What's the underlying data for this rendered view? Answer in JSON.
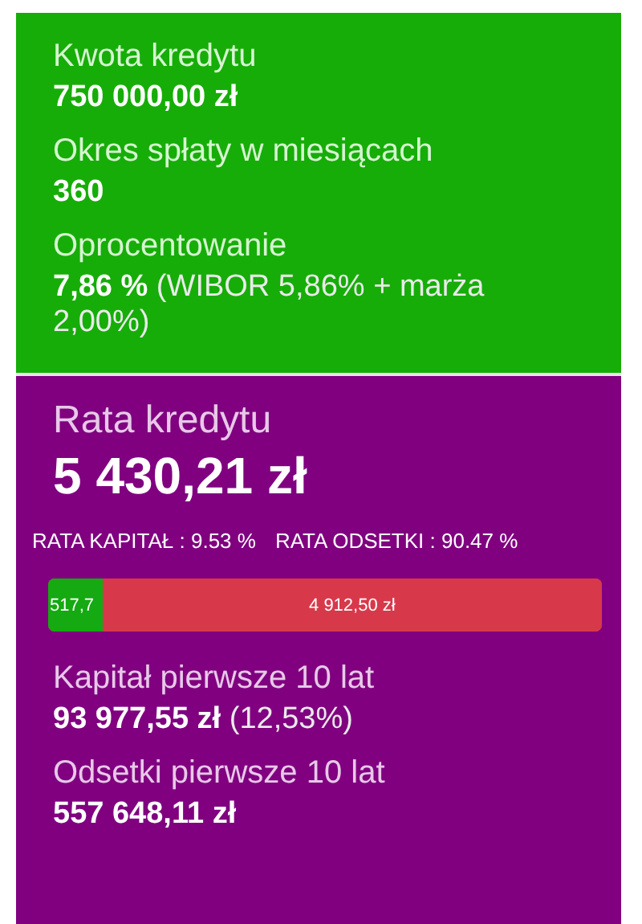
{
  "loan": {
    "fields": [
      {
        "label": "Kwota kredytu",
        "value": "750 000,00 zł"
      },
      {
        "label": "Okres spłaty w miesiącach",
        "value": "360"
      },
      {
        "label": "Oprocentowanie",
        "value": "7,86 %",
        "note": "(WIBOR 5,86% + marża 2,00%)"
      }
    ]
  },
  "installment": {
    "label": "Rata kredytu",
    "value": "5 430,21 zł",
    "capital_share": "RATA KAPITAŁ : 9.53 %",
    "interest_share": "RATA ODSETKI : 90.47 %",
    "split_bar": {
      "level": 0.0953,
      "capital_text": "517,7",
      "interest_text": "4 912,50 zł"
    },
    "fields": [
      {
        "label": "Kapitał pierwsze 10 lat",
        "value": "93 977,55 zł",
        "note": "(12,53%)"
      },
      {
        "label": "Odsetki pierwsze 10 lat",
        "value": "557 648,11 zł"
      }
    ]
  }
}
